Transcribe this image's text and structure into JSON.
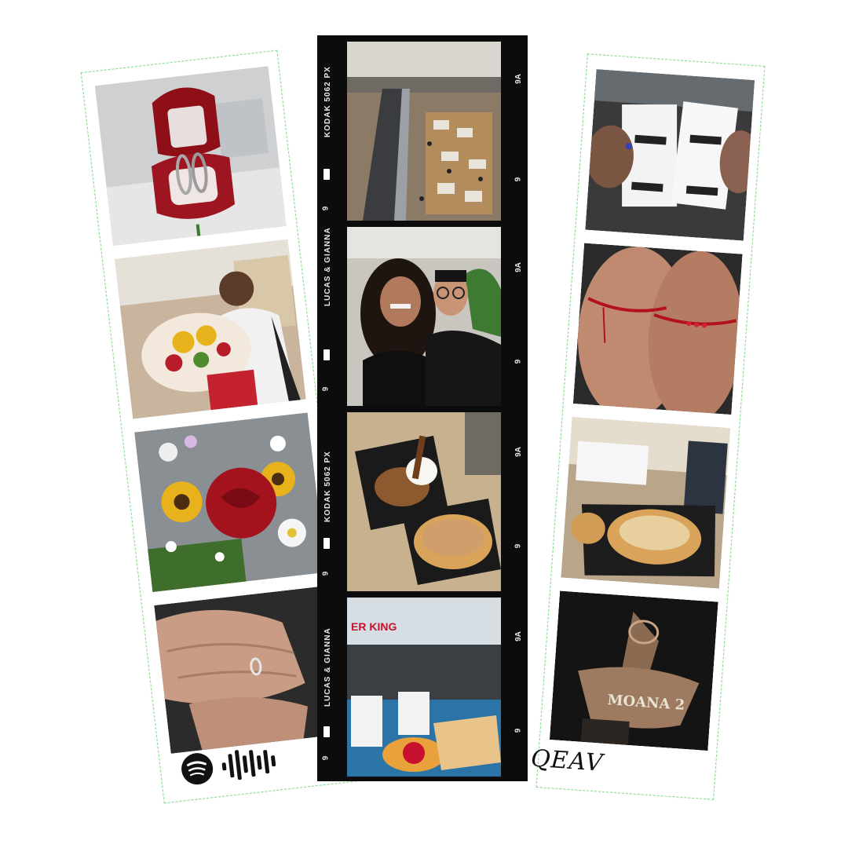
{
  "film_strip": {
    "edge_label_1": "KODAK 5062 PX",
    "edge_label_2": "LUCAS & GIANNA",
    "frame_number_a": "9A",
    "frame_number_b": "9"
  },
  "left_strip": {
    "spotify_code_label": "spotify-logo"
  },
  "right_strip": {
    "signature_text": "QEAV"
  },
  "photos": {
    "ring_box": "ring-box-photo",
    "bouquet_man": "man-holding-bouquet-photo",
    "rose_bouquet": "rose-sunflower-bouquet-photo",
    "hands_ring": "hands-with-ring-photo",
    "mall_escalator": "mall-escalator-photo",
    "couple_selfie": "couple-selfie-photo",
    "waffles": "waffles-photo",
    "burger_king": "burger-king-meal-photo",
    "receipts": "movie-receipts-photo",
    "red_threads": "red-thread-bracelets-photo",
    "waffle_table": "waffle-on-table-photo",
    "moana_popcorn": "moana-2-popcorn-bucket-photo"
  },
  "colors": {
    "film": "#0c0c0c",
    "dashed_border": "#7fdc8a",
    "rose": "#a3121d",
    "sunflower": "#e8b21c"
  }
}
